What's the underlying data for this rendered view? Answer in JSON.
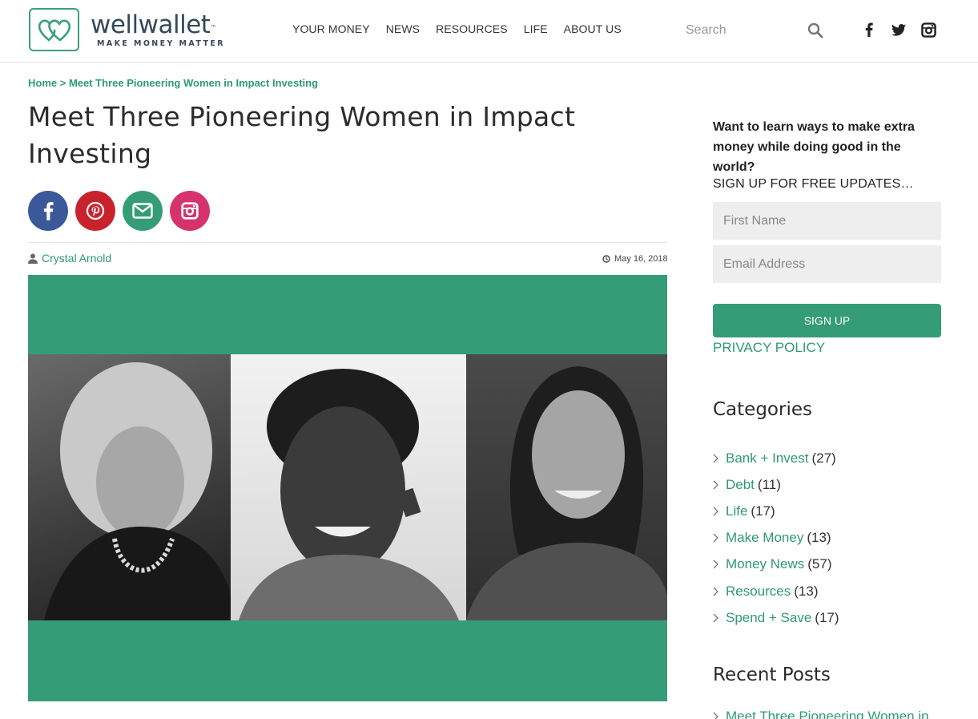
{
  "brand": {
    "name": "wellwallet",
    "tm": "™",
    "tagline": "MAKE MONEY MATTER"
  },
  "nav": [
    "YOUR MONEY",
    "NEWS",
    "RESOURCES",
    "LIFE",
    "ABOUT US"
  ],
  "search": {
    "placeholder": "Search"
  },
  "breadcrumb": {
    "home": "Home",
    "sep": " > ",
    "current": "Meet Three Pioneering Women in Impact Investing"
  },
  "article": {
    "title": "Meet Three Pioneering Women in Impact Investing",
    "author": "Crystal Arnold",
    "date": "May 16, 2018"
  },
  "share": [
    "facebook",
    "pinterest",
    "email",
    "instagram"
  ],
  "colors": {
    "accent": "#359c78",
    "facebook": "#3b5998",
    "pinterest": "#c8232c",
    "email": "#359c78",
    "instagram": "#d6336c"
  },
  "signup": {
    "headline": "Want to learn ways to make extra money while doing good in the world?",
    "subhead": "SIGN UP FOR FREE UPDATES…",
    "first_name_placeholder": "First Name",
    "email_placeholder": "Email Address",
    "button": "SIGN UP",
    "privacy": "PRIVACY POLICY"
  },
  "categories": {
    "heading": "Categories",
    "items": [
      {
        "label": "Bank + Invest",
        "count": "(27)"
      },
      {
        "label": "Debt",
        "count": "(11)"
      },
      {
        "label": "Life",
        "count": "(17)"
      },
      {
        "label": "Make Money",
        "count": "(13)"
      },
      {
        "label": "Money News",
        "count": "(57)"
      },
      {
        "label": "Resources",
        "count": "(13)"
      },
      {
        "label": "Spend + Save",
        "count": "(17)"
      }
    ]
  },
  "recent": {
    "heading": "Recent Posts",
    "first": "Meet Three Pioneering Women in"
  }
}
